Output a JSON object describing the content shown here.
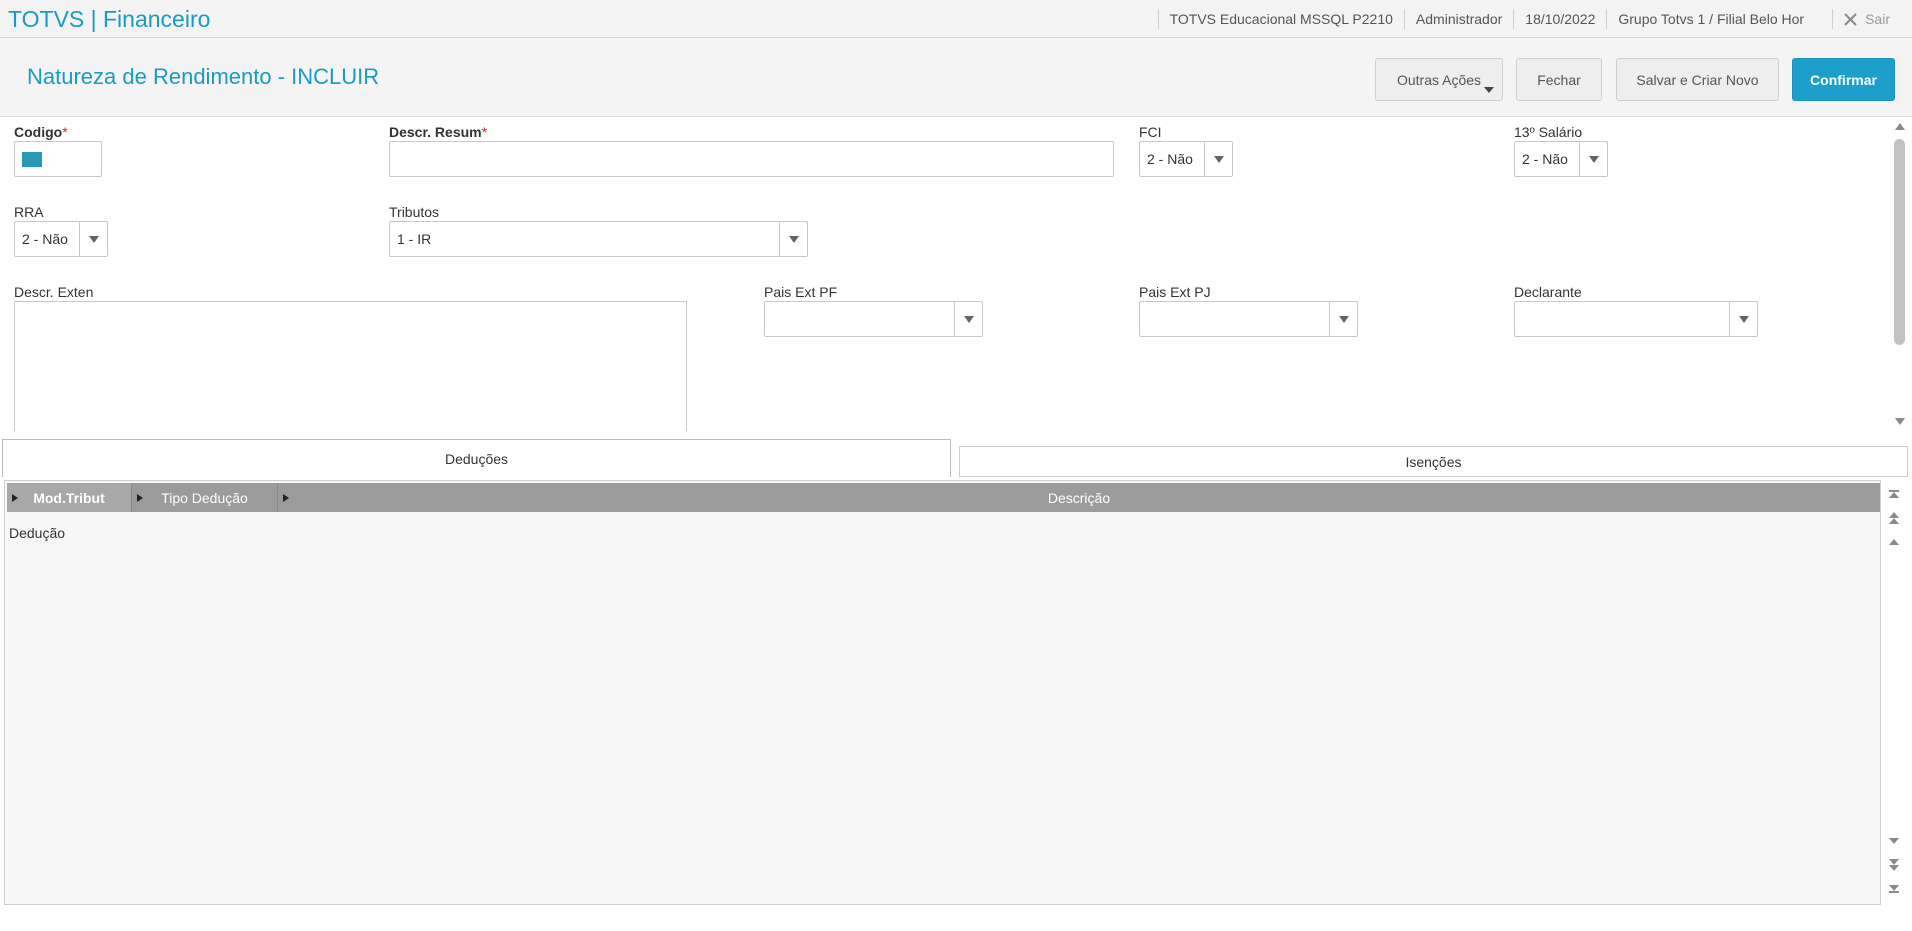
{
  "app": {
    "title": "TOTVS | Financeiro"
  },
  "topbar": {
    "environment": "TOTVS Educacional MSSQL P2210",
    "user": "Administrador",
    "date": "18/10/2022",
    "branch": "Grupo Totvs 1 / Filial Belo Hor",
    "exit_label": "Sair"
  },
  "header": {
    "title": "Natureza de Rendimento - INCLUIR",
    "buttons": {
      "other_actions": "Outras Ações",
      "close": "Fechar",
      "save_new": "Salvar e Criar Novo",
      "confirm": "Confirmar"
    }
  },
  "form": {
    "codigo": {
      "label": "Codigo",
      "value": ""
    },
    "descr_resum": {
      "label": "Descr. Resum",
      "value": ""
    },
    "fci": {
      "label": "FCI",
      "value": "2 - Não"
    },
    "decimo_terceiro": {
      "label": "13º Salário",
      "value": "2 - Não"
    },
    "rra": {
      "label": "RRA",
      "value": "2 - Não"
    },
    "tributos": {
      "label": "Tributos",
      "value": "1 - IR"
    },
    "descr_exten": {
      "label": "Descr. Exten",
      "value": ""
    },
    "pais_ext_pf": {
      "label": "Pais Ext PF",
      "value": ""
    },
    "pais_ext_pj": {
      "label": "Pais Ext PJ",
      "value": ""
    },
    "declarante": {
      "label": "Declarante",
      "value": ""
    },
    "required_mark": "*"
  },
  "tabs": [
    {
      "label": "Deduções",
      "active": true
    },
    {
      "label": "Isenções",
      "active": false
    }
  ],
  "grid": {
    "columns": [
      "Mod.Tribut",
      "Tipo Dedução",
      "Descrição"
    ],
    "rows": [
      "Dedução"
    ]
  },
  "colors": {
    "accent": "#1a9bc0",
    "primary_button": "#1d9fcc",
    "grid_header": "#9b9b9b"
  }
}
